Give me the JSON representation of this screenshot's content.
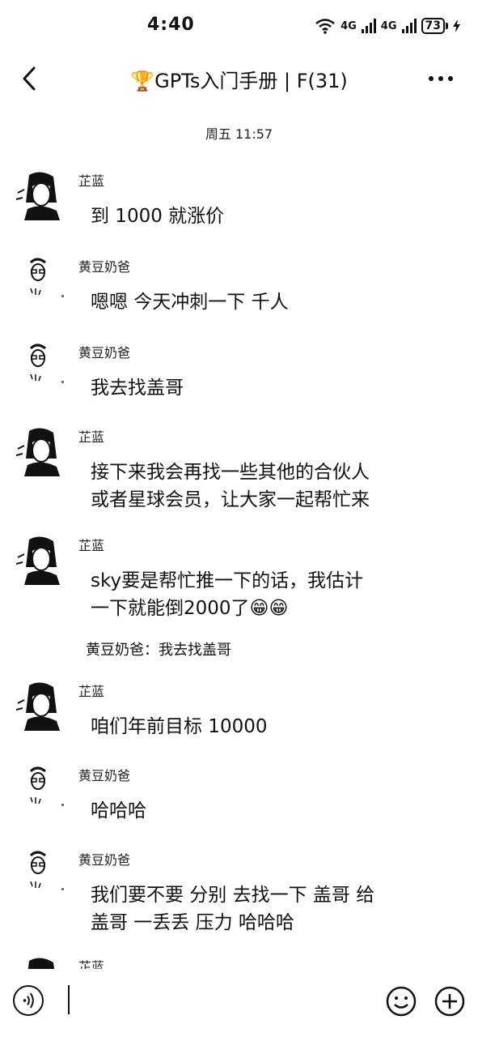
{
  "status": {
    "time": "4:40",
    "net1": "4G",
    "net2": "4G",
    "battery": "73"
  },
  "header": {
    "title": "🏆GPTs入门手册 | F(31)"
  },
  "chat": {
    "timestamp": "周五 11:57",
    "messages": [
      {
        "sender": "芷蓝",
        "lines": [
          "到 1000 就涨价"
        ]
      },
      {
        "sender": "黄豆奶爸",
        "lines": [
          "嗯嗯 今天冲刺一下 千人"
        ]
      },
      {
        "sender": "黄豆奶爸",
        "lines": [
          "我去找盖哥"
        ]
      },
      {
        "sender": "芷蓝",
        "lines": [
          "接下来我会再找一些其他的合伙人",
          "或者星球会员，让大家一起帮忙来"
        ]
      },
      {
        "sender": "芷蓝",
        "lines": [
          "sky要是帮忙推一下的话，我估计",
          "一下就能倒2000了😁😁"
        ]
      },
      {
        "sender": "芷蓝",
        "lines": [
          "咱们年前目标 10000"
        ]
      },
      {
        "sender": "黄豆奶爸",
        "lines": [
          "哈哈哈"
        ]
      },
      {
        "sender": "黄豆奶爸",
        "lines": [
          "我们要不要 分别 去找一下 盖哥 给",
          "盖哥 一丢丢 压力 哈哈哈"
        ]
      },
      {
        "sender": "芷蓝",
        "lines": []
      }
    ],
    "quote": "黄豆奶爸：我去找盖哥"
  },
  "icons": {
    "back": "chevron-left-icon",
    "more": "more-dots-icon",
    "voice": "voice-icon",
    "emoji": "emoji-icon",
    "plus": "plus-icon"
  }
}
